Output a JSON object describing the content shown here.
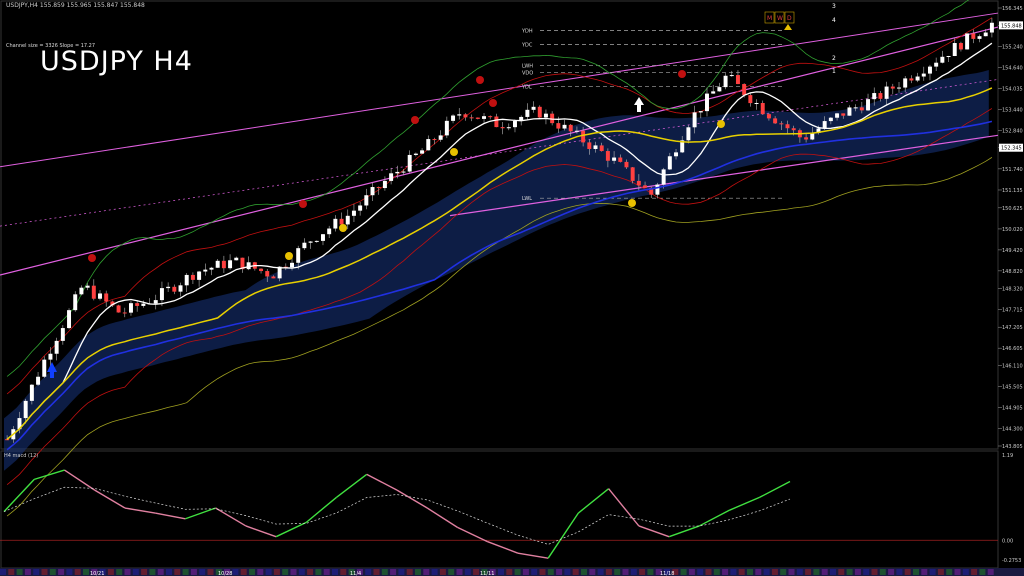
{
  "header": {
    "info": "USDJPY,H4 155.859 155.965 155.847 155.848",
    "chart_title": "USDJPY H4",
    "channel_info": "Channel size = 3326 Slope = 17.27",
    "indicator_label": "H4 macd (12)"
  },
  "colors": {
    "background": "#000000",
    "channel_line": "#e060e0",
    "ma_white": "#ffffff",
    "ma_yellow": "#e8d000",
    "ma_blue": "#2030e0",
    "macd_up": "#40e040",
    "macd_down": "#e080a0",
    "cloud": "#1a3a8a"
  },
  "chart_data": [
    {
      "type": "line",
      "title": "USDJPY H4",
      "x": [
        "10/21",
        "10/28",
        "11/4",
        "11/11",
        "11/18"
      ],
      "ylim": [
        143.805,
        156.345
      ],
      "y_ticks": [
        156.345,
        155.84,
        155.24,
        154.64,
        154.035,
        153.44,
        152.84,
        152.346,
        151.74,
        151.135,
        150.625,
        150.02,
        149.42,
        148.82,
        148.32,
        147.715,
        147.205,
        146.605,
        146.11,
        145.505,
        144.905,
        144.3,
        143.805
      ],
      "highlighted_ticks": [
        "155.848",
        "152.345"
      ],
      "levels": [
        {
          "name": "YDH",
          "value": 155.7
        },
        {
          "name": "YDC",
          "value": 155.3
        },
        {
          "name": "VDO",
          "value": 154.5
        },
        {
          "name": "LWH",
          "value": 154.7
        },
        {
          "name": "YDL",
          "value": 154.1
        },
        {
          "name": "LWL",
          "value": 150.9
        }
      ],
      "series": [
        {
          "name": "",
          "values": [
            144.0,
            146.3,
            148.4,
            147.6,
            148.1,
            148.8,
            149.1,
            148.7,
            149.7,
            150.4,
            151.4,
            152.3,
            153.4,
            153.0,
            153.4,
            152.7,
            152.0,
            151.0,
            153.1,
            154.4,
            153.4,
            152.6,
            153.3,
            153.8,
            154.5,
            155.2,
            155.9
          ]
        }
      ]
    },
    {
      "type": "line",
      "title": "",
      "ylim": [
        -0.2753,
        1.19
      ],
      "y_ticks": [
        1.19,
        0.0,
        -0.2753
      ],
      "series": [
        {
          "name": "",
          "values": [
            0.4,
            0.85,
            0.98,
            0.7,
            0.45,
            0.38,
            0.3,
            0.45,
            0.2,
            0.05,
            0.25,
            0.6,
            0.92,
            0.7,
            0.45,
            0.18,
            -0.02,
            -0.18,
            -0.25,
            0.38,
            0.72,
            0.2,
            0.05,
            0.2,
            0.42,
            0.6,
            0.82
          ]
        }
      ]
    }
  ],
  "right_labels": [
    "3",
    "4",
    "2",
    "1"
  ],
  "marker_labels": [
    "M",
    "W",
    "D"
  ]
}
